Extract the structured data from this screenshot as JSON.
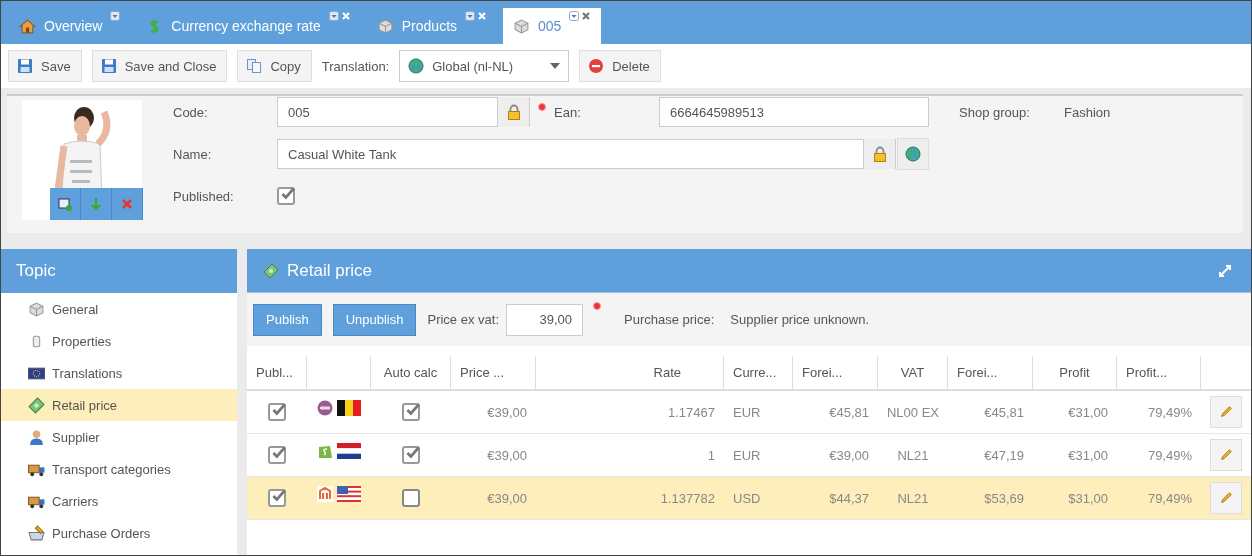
{
  "tabs": [
    {
      "label": "Overview",
      "kind": "home",
      "selected": false,
      "closable": false
    },
    {
      "label": "Currency exchange rate",
      "kind": "dollar",
      "selected": false,
      "closable": true
    },
    {
      "label": "Products",
      "kind": "box",
      "selected": false,
      "closable": true
    },
    {
      "label": "005",
      "kind": "box",
      "selected": true,
      "closable": true
    }
  ],
  "toolbar": {
    "buttons": [
      {
        "label": "Save",
        "kind": "save"
      },
      {
        "label": "Save and Close",
        "kind": "save"
      },
      {
        "label": "Copy",
        "kind": "copy"
      }
    ],
    "translation": {
      "label": "Translation:",
      "value": "Global (nl-NL)"
    },
    "delete_button": "Delete"
  },
  "product": {
    "code": {
      "label": "Code:",
      "value": "005",
      "required": true
    },
    "ean": {
      "label": "Ean:",
      "value": "6664645989513"
    },
    "shop_group": {
      "label": "Shop group:",
      "value": "Fashion"
    },
    "name": {
      "label": "Name:",
      "value": "Casual White Tank"
    },
    "published": {
      "label": "Published:",
      "checked": true
    }
  },
  "sidebar": {
    "title": "Topic",
    "items": [
      {
        "label": "General",
        "kind": "box",
        "selected": false
      },
      {
        "label": "Properties",
        "kind": "cylinder",
        "selected": false
      },
      {
        "label": "Translations",
        "kind": "eu",
        "selected": false
      },
      {
        "label": "Retail price",
        "kind": "money",
        "selected": true
      },
      {
        "label": "Supplier",
        "kind": "person",
        "selected": false
      },
      {
        "label": "Transport categories",
        "kind": "truck",
        "selected": false
      },
      {
        "label": "Carriers",
        "kind": "truck",
        "selected": false
      },
      {
        "label": "Purchase Orders",
        "kind": "basket",
        "selected": false
      }
    ]
  },
  "panel": {
    "title": "Retail price",
    "buttons": [
      "Publish",
      "Unpublish"
    ],
    "price_ex_vat": {
      "label": "Price ex vat:",
      "value": "39,00",
      "required": true
    },
    "purchase_price": {
      "label": "Purchase price:",
      "value": "Supplier price unknown."
    }
  },
  "table": {
    "columns": [
      "Publ...",
      "Auto calc",
      "Price ...",
      "Rate",
      "Curre...",
      "Forei...",
      "VAT",
      "Forei...",
      "Profit",
      "Profit..."
    ],
    "rows": [
      {
        "published": true,
        "logos": [
          {
            "kind": "woo"
          },
          {
            "kind": "be"
          }
        ],
        "auto_calc": true,
        "price": "€39,00",
        "rate": "1.17467",
        "currency": "EUR",
        "foreign_price": "€45,81",
        "vat": "NL00 EX",
        "foreign_price_vat": "€45,81",
        "profit": "€31,00",
        "profit_pct": "79,49%",
        "selected": false
      },
      {
        "published": true,
        "logos": [
          {
            "kind": "shopify"
          },
          {
            "kind": "nl"
          }
        ],
        "auto_calc": true,
        "price": "€39,00",
        "rate": "1",
        "currency": "EUR",
        "foreign_price": "€39,00",
        "vat": "NL21",
        "foreign_price_vat": "€47,19",
        "profit": "€31,00",
        "profit_pct": "79,49%",
        "selected": false
      },
      {
        "published": true,
        "logos": [
          {
            "kind": "magento"
          },
          {
            "kind": "us"
          }
        ],
        "auto_calc": false,
        "price": "€39,00",
        "rate": "1.137782",
        "currency": "USD",
        "foreign_price": "$44,37",
        "vat": "NL21",
        "foreign_price_vat": "$53,69",
        "profit": "$31,00",
        "profit_pct": "79,49%",
        "selected": true
      }
    ]
  }
}
